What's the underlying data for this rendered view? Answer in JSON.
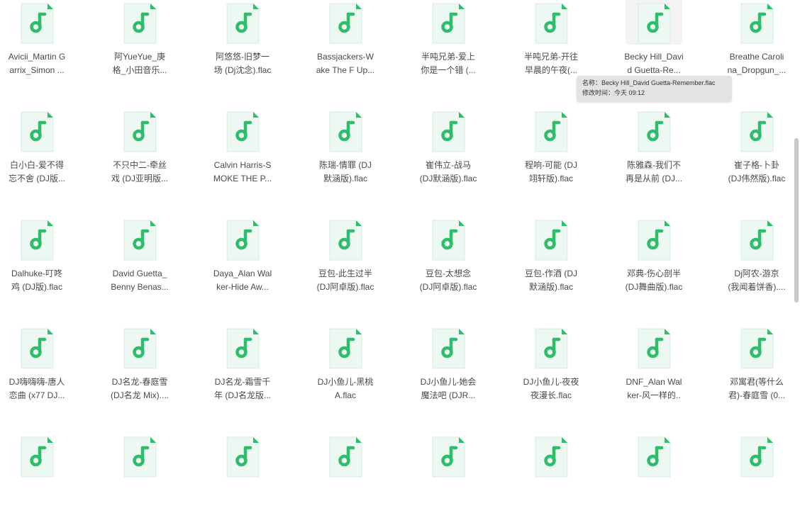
{
  "files": [
    {
      "line1": "Avicii_Martin G",
      "line2": "arrix_Simon ..."
    },
    {
      "line1": "阿YueYue_庚",
      "line2": "格_小田音乐..."
    },
    {
      "line1": "阿悠悠-旧梦一",
      "line2": "场 (Dj沈念).flac"
    },
    {
      "line1": "Bassjackers-W",
      "line2": "ake The F Up..."
    },
    {
      "line1": "半吨兄弟-爱上",
      "line2": "你是一个错 (..."
    },
    {
      "line1": "半吨兄弟-开往",
      "line2": "早晨的午夜(..."
    },
    {
      "line1": "Becky Hill_Davi",
      "line2": "d Guetta-Re..."
    },
    {
      "line1": "Breathe Caroli",
      "line2": "na_Dropgun_..."
    },
    {
      "line1": "白小白-爱不得",
      "line2": "忘不舍 (DJ版..."
    },
    {
      "line1": "不只中二-牵丝",
      "line2": "戏 (DJ亚明版..."
    },
    {
      "line1": "Calvin Harris-S",
      "line2": "MOKE THE P..."
    },
    {
      "line1": "陈瑞-情罪 (DJ",
      "line2": "默涵版).flac"
    },
    {
      "line1": "崔伟立-战马",
      "line2": "(DJ默涵版).flac"
    },
    {
      "line1": "程响-可能 (DJ",
      "line2": "翊轩版).flac"
    },
    {
      "line1": "陈雅森-我们不",
      "line2": "再是从前 (DJ..."
    },
    {
      "line1": "崔子格-卜卦",
      "line2": "(DJ伟然版).flac"
    },
    {
      "line1": "Dalhuke-叮咚",
      "line2": "鸡 (DJ版).flac"
    },
    {
      "line1": "David Guetta_",
      "line2": "Benny Benas..."
    },
    {
      "line1": "Daya_Alan Wal",
      "line2": "ker-Hide Aw..."
    },
    {
      "line1": "豆包-此生过半",
      "line2": "(DJ阿卓版).flac"
    },
    {
      "line1": "豆包-太想念",
      "line2": "(DJ阿卓版).flac"
    },
    {
      "line1": "豆包-作酒 (DJ",
      "line2": "默涵版).flac"
    },
    {
      "line1": "邓典-伤心剖半",
      "line2": "(DJ舞曲版).flac"
    },
    {
      "line1": "Dj阿农-游京",
      "line2": "(我闻着饼香)...."
    },
    {
      "line1": "DJ嗨嗨嗨-唐人",
      "line2": "恋曲 (x77 DJ..."
    },
    {
      "line1": "DJ名龙-春庭雪",
      "line2": "(DJ名龙 Mix)...."
    },
    {
      "line1": "DJ名龙-霜雪千",
      "line2": "年 (DJ名龙版..."
    },
    {
      "line1": "DJ小鱼儿-黑桃",
      "line2": "A.flac"
    },
    {
      "line1": "DJ小鱼儿-她会",
      "line2": "魔法吧 (DJR..."
    },
    {
      "line1": "DJ小鱼儿-夜夜",
      "line2": "夜漫长.flac"
    },
    {
      "line1": "DNF_Alan Wal",
      "line2": "ker-风一样的.."
    },
    {
      "line1": "邓寓君(等什么",
      "line2": "君)-春庭雪 (0..."
    },
    {
      "line1": "",
      "line2": ""
    },
    {
      "line1": "",
      "line2": ""
    },
    {
      "line1": "",
      "line2": ""
    },
    {
      "line1": "",
      "line2": ""
    },
    {
      "line1": "",
      "line2": ""
    },
    {
      "line1": "",
      "line2": ""
    },
    {
      "line1": "",
      "line2": ""
    },
    {
      "line1": "",
      "line2": ""
    }
  ],
  "tooltip": {
    "name_line": "名称：Becky Hill_David Guetta-Remember.flac",
    "time_line": "修改时间：今天 09:12"
  },
  "icon": {
    "name": "music-note-file-icon",
    "color": "#2ebd6b",
    "page_color": "#ecf8f1"
  },
  "hovered_index": 6
}
